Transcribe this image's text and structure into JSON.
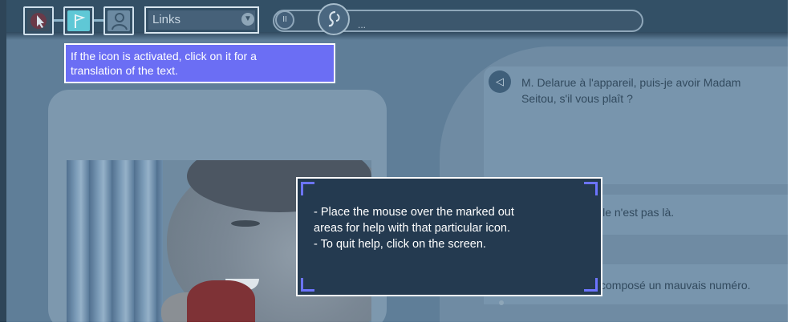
{
  "toolbar": {
    "links_dropdown": {
      "selected": "Links"
    },
    "audio": {
      "pause_symbol": "II",
      "progress_text": "..."
    }
  },
  "tooltip": {
    "line1": "If the icon is activated, click on it for a",
    "line2": "translation of the text."
  },
  "dialogue": {
    "line1_a": "M. Delarue à l'appareil, puis-je avoir Madam",
    "line1_b": "Seitou, s'il vous plaît ?",
    "line2": "lle n'est pas là.",
    "line3": "composé un mauvais numéro."
  },
  "help_overlay": {
    "line1": "- Place the mouse over the marked out",
    "line2": "areas for help with that particular icon.",
    "line3": "- To quit help, click on the screen."
  },
  "icons": {
    "pointer": "cursor-arrow-icon",
    "translate": "flag-icon",
    "help": "person-help-icon",
    "dropdown": "chevron-down-icon",
    "replay": "ear-icon",
    "speaker": "speaker-icon"
  },
  "colors": {
    "tooltip_bg": "#6b6ef4",
    "overlay_bg": "#243a50",
    "overlay_corner": "#6c74ff"
  }
}
